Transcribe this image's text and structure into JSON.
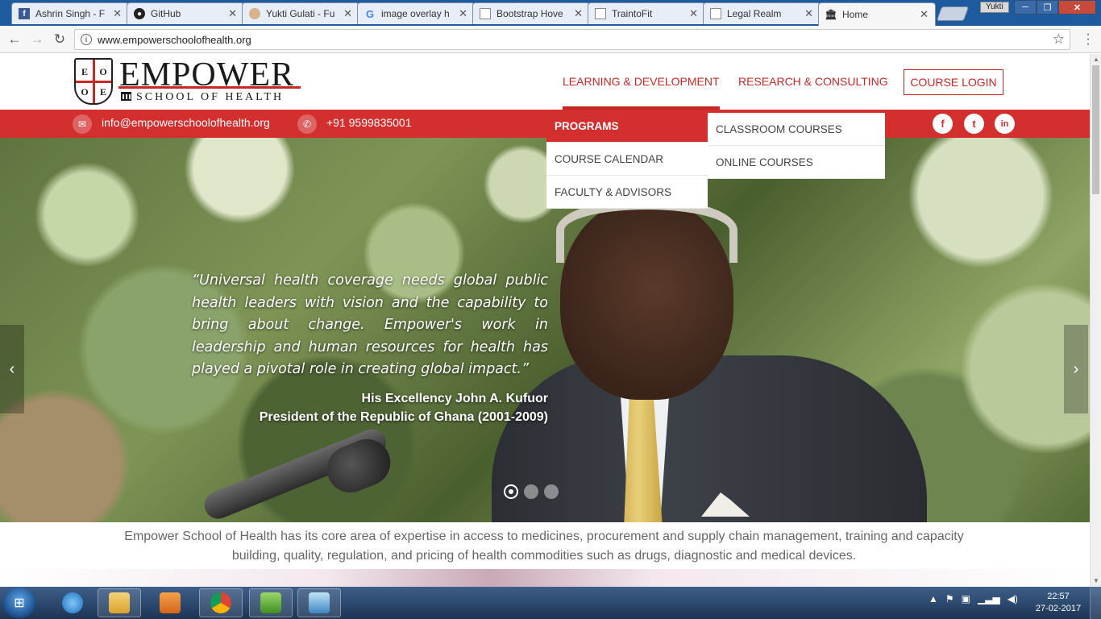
{
  "browser": {
    "tabs": [
      {
        "label": "Ashrin Singh - F",
        "favicon": "F"
      },
      {
        "label": "GitHub",
        "favicon": "github-icon"
      },
      {
        "label": "Yukti Gulati - Fu",
        "favicon": "avatar"
      },
      {
        "label": "image overlay h",
        "favicon": "G"
      },
      {
        "label": "Bootstrap Hove",
        "favicon": "page-icon"
      },
      {
        "label": "TraintoFit",
        "favicon": "page-icon"
      },
      {
        "label": "Legal Realm",
        "favicon": "page-icon"
      },
      {
        "label": "Home",
        "favicon": "building-icon"
      }
    ],
    "user": "Yukti",
    "url": "www.empowerschoolofhealth.org"
  },
  "site": {
    "logo_name": "EMPOWER",
    "logo_sub": "SCHOOL OF HEALTH",
    "logo_letters": [
      "E",
      "O",
      "O",
      "E"
    ],
    "nav": {
      "learning": "LEARNING & DEVELOPMENT",
      "research": "RESEARCH & CONSULTING",
      "login": "COURSE LOGIN"
    },
    "contact": {
      "email": "info@empowerschoolofhealth.org",
      "phone": "+91 9599835001"
    },
    "social": [
      "f",
      "t",
      "in"
    ],
    "dropdown": {
      "level1": [
        "PROGRAMS",
        "COURSE CALENDAR",
        "FACULTY & ADVISORS"
      ],
      "level2": [
        "CLASSROOM COURSES",
        "ONLINE COURSES"
      ]
    },
    "hero": {
      "quote": "“Universal health coverage needs global public health leaders with vision and the capability to bring about change. Empower's work in leadership and human resources for health has played a pivotal role in creating global impact.”",
      "author_name": "His Excellency John A. Kufuor",
      "author_title": "President of the Republic of Ghana (2001-2009)",
      "slides": 3,
      "active_slide": 1
    },
    "intro": "Empower School of Health has its core area of expertise in access to medicines, procurement and supply chain management, training and capacity building, quality, regulation, and pricing of health commodities such as drugs, diagnostic and medical devices."
  },
  "taskbar": {
    "time": "22:57",
    "date": "27-02-2017"
  },
  "colors": {
    "brand_red": "#d32f2f",
    "nav_red": "#c62828"
  }
}
